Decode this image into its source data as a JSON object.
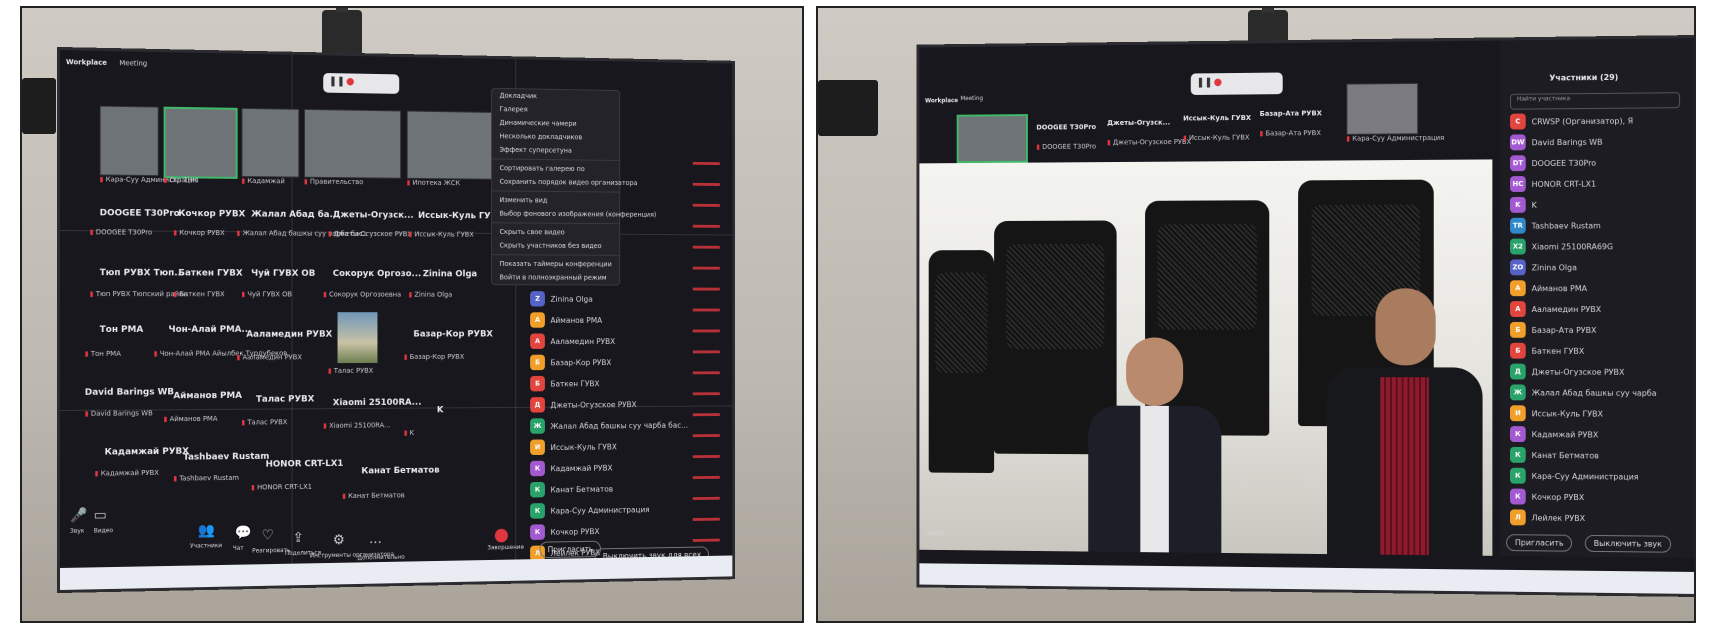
{
  "left_photo": {
    "app": {
      "title": "Workplace",
      "meeting": "Meeting"
    },
    "thumbs": [
      {
        "label": "Кара-Суу Администрация"
      },
      {
        "label": "Ош ТНК"
      },
      {
        "label": "Кадамжай"
      },
      {
        "label": "Правительство"
      },
      {
        "label": "Ипотека ЖСК"
      }
    ],
    "grid_rows": [
      [
        {
          "title": "DOOGEE T30Pro",
          "sub": "DOOGEE T30Pro"
        },
        {
          "title": "Кочкор РУВХ",
          "sub": "Кочкор РУВХ"
        },
        {
          "title": "Жалал Абад ба...",
          "sub": "Жалал Абад башкы суу чарба бас..."
        },
        {
          "title": "Джеты-Огузск...",
          "sub": "Джеты-Огузское РУВХ"
        },
        {
          "title": "Иссык-Куль ГУВХ",
          "sub": "Иссык-Куль ГУВХ"
        }
      ],
      [
        {
          "title": "Тюп РУВХ Тюп...",
          "sub": "Тюп РУВХ Тюпский район"
        },
        {
          "title": "Баткен ГУВХ",
          "sub": "Баткен ГУВХ"
        },
        {
          "title": "Чуй ГУВХ ОВ",
          "sub": "Чуй ГУВХ ОВ"
        },
        {
          "title": "Сокорук Оргозо...",
          "sub": "Сокорук Оргозоевна"
        },
        {
          "title": "Zinina Olga",
          "sub": "Zinina Olga"
        }
      ],
      [
        {
          "title": "Тон РМА",
          "sub": "Тон РМА"
        },
        {
          "title": "Чон-Алай РМА...",
          "sub": "Чон-Алай РМА Айылбек Турдубеков"
        },
        {
          "title": "Ааламедин РУВХ",
          "sub": "Ааламедин РУВХ"
        },
        {
          "title": "",
          "sub": "Талас РУВХ"
        },
        {
          "title": "Базар-Кор РУВХ",
          "sub": "Базар-Кор РУВХ"
        }
      ],
      [
        {
          "title": "David Barings WB",
          "sub": "David Barings WB"
        },
        {
          "title": "Айманов РМА",
          "sub": "Айманов РМА"
        },
        {
          "title": "Талас РУВХ",
          "sub": "Талас РУВХ"
        },
        {
          "title": "Xiaomi 25100RA...",
          "sub": "Xiaomi 25100RA..."
        },
        {
          "title": "K",
          "sub": "K"
        }
      ],
      [
        {
          "title": "Кадамжай РУВХ",
          "sub": "Кадамжай РУВХ"
        },
        {
          "title": "Tashbaev Rustam",
          "sub": "Tashbaev Rustam"
        },
        {
          "title": "HONOR CRT-LX1",
          "sub": "HONOR CRT-LX1"
        },
        {
          "title": "Канат Бетматов",
          "sub": "Канат Бетматов"
        },
        {
          "title": "",
          "sub": ""
        }
      ]
    ],
    "menu": [
      "Докладчик",
      "Галерея",
      "Динамические чамери",
      "Несколько докладчиков",
      "Эффект суперсетуна",
      "Сортировать галерею по",
      "Сохранить порядок видео организатора",
      "Изменить вид",
      "Выбор фонового изображения (конференция)",
      "Скрыть свое видео",
      "Скрыть участников без видео",
      "Показать таймеры конференции",
      "Войти в полноэкранный режим"
    ],
    "participants": [
      {
        "initial": "Z",
        "name": "Zinina Olga",
        "color": "#5563c7"
      },
      {
        "initial": "А",
        "name": "Айманов РМА",
        "color": "#f0a02a"
      },
      {
        "initial": "А",
        "name": "Ааламедин РУВХ",
        "color": "#e1453e"
      },
      {
        "initial": "Б",
        "name": "Базар-Кор РУВХ",
        "color": "#f0a02a"
      },
      {
        "initial": "Б",
        "name": "Баткен ГУВХ",
        "color": "#e1453e"
      },
      {
        "initial": "Д",
        "name": "Джеты-Огузское РУВХ",
        "color": "#e1453e"
      },
      {
        "initial": "Ж",
        "name": "Жалал Абад башкы суу чарба бас...",
        "color": "#2aa36b"
      },
      {
        "initial": "И",
        "name": "Иссык-Куль ГУВХ",
        "color": "#f0a02a"
      },
      {
        "initial": "К",
        "name": "Кадамжай РУВХ",
        "color": "#a35ad1"
      },
      {
        "initial": "К",
        "name": "Канат Бетматов",
        "color": "#2aa36b"
      },
      {
        "initial": "К",
        "name": "Кара-Суу Администрация",
        "color": "#2aa36b"
      },
      {
        "initial": "К",
        "name": "Кочкор РУВХ",
        "color": "#a35ad1"
      },
      {
        "initial": "Л",
        "name": "Лейлек РУВХ",
        "color": "#f0a02a"
      }
    ],
    "bottom_buttons": {
      "invite": "Пригласить",
      "mute_all": "Выключить звук для всех",
      "leave": "Завершение"
    },
    "toolbar": [
      {
        "icon": "people-icon",
        "label": "Участники"
      },
      {
        "icon": "chat-icon",
        "label": "Чат"
      },
      {
        "icon": "reaction-icon",
        "label": "Реагировать"
      },
      {
        "icon": "share-icon",
        "label": "Поделиться"
      },
      {
        "icon": "tools-icon",
        "label": "Инструменты организатора"
      },
      {
        "icon": "more-icon",
        "label": "Дополнительно"
      }
    ],
    "mic_label": "Звук",
    "video_label": "Видео"
  },
  "right_photo": {
    "app": {
      "title": "Workplace",
      "meeting": "Meeting"
    },
    "top_thumbs": [
      {
        "title": "DOOGEE T30Pro",
        "sub": "DOOGEE T30Pro"
      },
      {
        "title": "Джеты-Огузск...",
        "sub": "Джеты-Огузское РУВХ"
      },
      {
        "title": "Иссык-Куль ГУВХ",
        "sub": "Иссык-Куль ГУВХ"
      },
      {
        "title": "Базар-Ата РУВХ",
        "sub": "Базар-Ата РУВХ"
      }
    ],
    "corner_thumb": "Кара-Суу Администрация",
    "participants_header": "Участники (29)",
    "search_placeholder": "Найти участника",
    "participants": [
      {
        "initial": "C",
        "name": "CRWSP (Организатор), Я",
        "color": "#e1453e"
      },
      {
        "initial": "DW",
        "name": "David Barings WB",
        "color": "#a35ad1"
      },
      {
        "initial": "DT",
        "name": "DOOGEE T30Pro",
        "color": "#a35ad1"
      },
      {
        "initial": "HC",
        "name": "HONOR CRT-LX1",
        "color": "#a35ad1"
      },
      {
        "initial": "K",
        "name": "K",
        "color": "#a35ad1"
      },
      {
        "initial": "TR",
        "name": "Tashbaev Rustam",
        "color": "#2f89c9"
      },
      {
        "initial": "X2",
        "name": "Xiaomi 25100RA69G",
        "color": "#2aa36b"
      },
      {
        "initial": "ZO",
        "name": "Zinina Olga",
        "color": "#5563c7"
      },
      {
        "initial": "А",
        "name": "Айманов РМА",
        "color": "#f0a02a"
      },
      {
        "initial": "А",
        "name": "Ааламедин РУВХ",
        "color": "#e1453e"
      },
      {
        "initial": "Б",
        "name": "Базар-Ата РУВХ",
        "color": "#f0a02a"
      },
      {
        "initial": "Б",
        "name": "Баткен ГУВХ",
        "color": "#e1453e"
      },
      {
        "initial": "Д",
        "name": "Джеты-Огузское РУВХ",
        "color": "#2aa36b"
      },
      {
        "initial": "Ж",
        "name": "Жалал Абад башкы суу чарба",
        "color": "#2aa36b"
      },
      {
        "initial": "И",
        "name": "Иссык-Куль ГУВХ",
        "color": "#f0a02a"
      },
      {
        "initial": "К",
        "name": "Кадамжай РУВХ",
        "color": "#a35ad1"
      },
      {
        "initial": "К",
        "name": "Канат Бетматов",
        "color": "#2aa36b"
      },
      {
        "initial": "К",
        "name": "Кара-Суу Администрация",
        "color": "#2aa36b"
      },
      {
        "initial": "К",
        "name": "Кочкор РУВХ",
        "color": "#a35ad1"
      },
      {
        "initial": "Л",
        "name": "Лейлек РУВХ",
        "color": "#f0a02a"
      }
    ],
    "bottom_buttons": {
      "invite": "Пригласить",
      "mute_all": "Выключить звук"
    },
    "speaker_label": "CRWSP"
  }
}
